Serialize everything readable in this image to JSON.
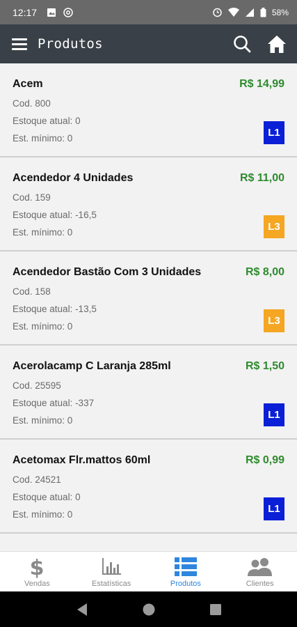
{
  "status_bar": {
    "time": "12:17",
    "battery": "58%"
  },
  "appbar": {
    "title": "Produtos"
  },
  "products": [
    {
      "name": "Acem",
      "price": "R$ 14,99",
      "code": "Cod. 800",
      "stock": "Estoque atual: 0",
      "minimum": "Est. mínimo: 0",
      "badge": "L1",
      "badge_color": "#0a1fd6"
    },
    {
      "name": "Acendedor 4 Unidades",
      "price": "R$ 11,00",
      "code": "Cod. 159",
      "stock": "Estoque atual: -16,5",
      "minimum": "Est. mínimo: 0",
      "badge": "L3",
      "badge_color": "#f5a623"
    },
    {
      "name": "Acendedor Bastão Com 3 Unidades",
      "price": "R$ 8,00",
      "code": "Cod. 158",
      "stock": "Estoque atual: -13,5",
      "minimum": "Est. mínimo: 0",
      "badge": "L3",
      "badge_color": "#f5a623"
    },
    {
      "name": "Acerolacamp C Laranja 285ml",
      "price": "R$ 1,50",
      "code": "Cod. 25595",
      "stock": "Estoque atual: -337",
      "minimum": "Est. mínimo: 0",
      "badge": "L1",
      "badge_color": "#0a1fd6"
    },
    {
      "name": "Acetomax Flr.mattos 60ml",
      "price": "R$ 0,99",
      "code": "Cod. 24521",
      "stock": "Estoque atual: 0",
      "minimum": "Est. mínimo: 0",
      "badge": "L1",
      "badge_color": "#0a1fd6"
    }
  ],
  "bottom_nav": [
    {
      "label": "Vendas",
      "icon": "dollar-icon"
    },
    {
      "label": "Estatísticas",
      "icon": "bar-chart-icon"
    },
    {
      "label": "Produtos",
      "icon": "list-icon",
      "active": true
    },
    {
      "label": "Clientes",
      "icon": "people-icon"
    }
  ],
  "colors": {
    "price_green": "#2e8b2e",
    "appbar": "#3a4047",
    "active_nav": "#2e86de"
  }
}
